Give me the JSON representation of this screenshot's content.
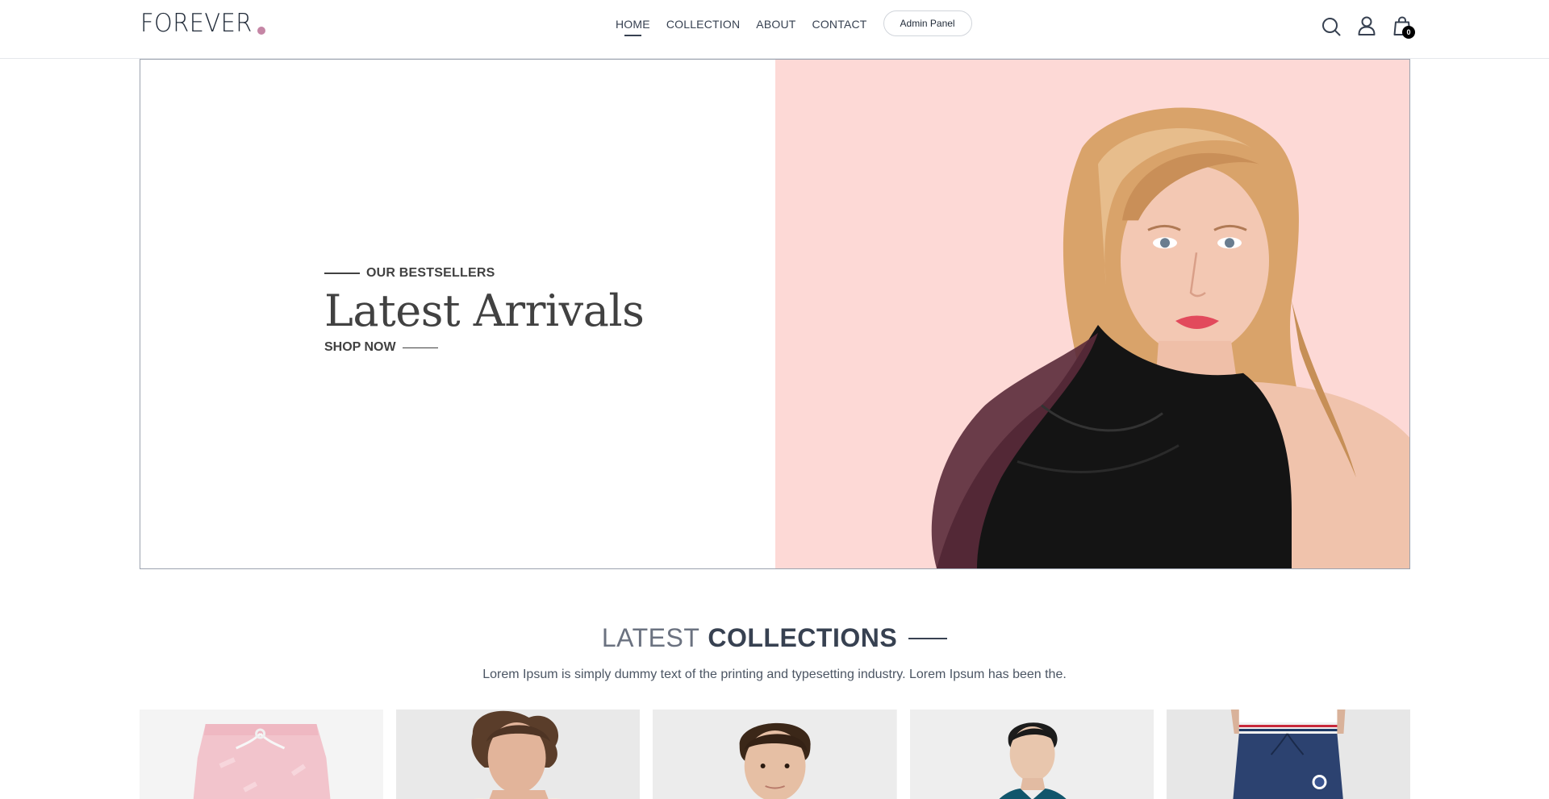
{
  "brand": {
    "logo_text": "FOREVER",
    "accent_color": "#c586a5"
  },
  "nav": {
    "links": [
      {
        "label": "HOME",
        "active": true
      },
      {
        "label": "COLLECTION",
        "active": false
      },
      {
        "label": "ABOUT",
        "active": false
      },
      {
        "label": "CONTACT",
        "active": false
      }
    ],
    "admin_button": "Admin Panel",
    "icons": [
      "search-icon",
      "profile-icon",
      "cart-icon"
    ],
    "cart_count": "0"
  },
  "hero": {
    "eyebrow": "OUR BESTSELLERS",
    "title": "Latest Arrivals",
    "cta": "SHOP NOW",
    "image_background": "#fdd9d6"
  },
  "latest_collections": {
    "title_light": "LATEST",
    "title_bold": "COLLECTIONS",
    "description": "Lorem Ipsum is simply dummy text of the printing and typesetting industry. Lorem Ipsum has been the."
  },
  "products": [
    {
      "image": "pink-shorts"
    },
    {
      "image": "man-curly-hair"
    },
    {
      "image": "boy-portrait"
    },
    {
      "image": "woman-teal-jacket"
    },
    {
      "image": "navy-track-pants"
    }
  ]
}
